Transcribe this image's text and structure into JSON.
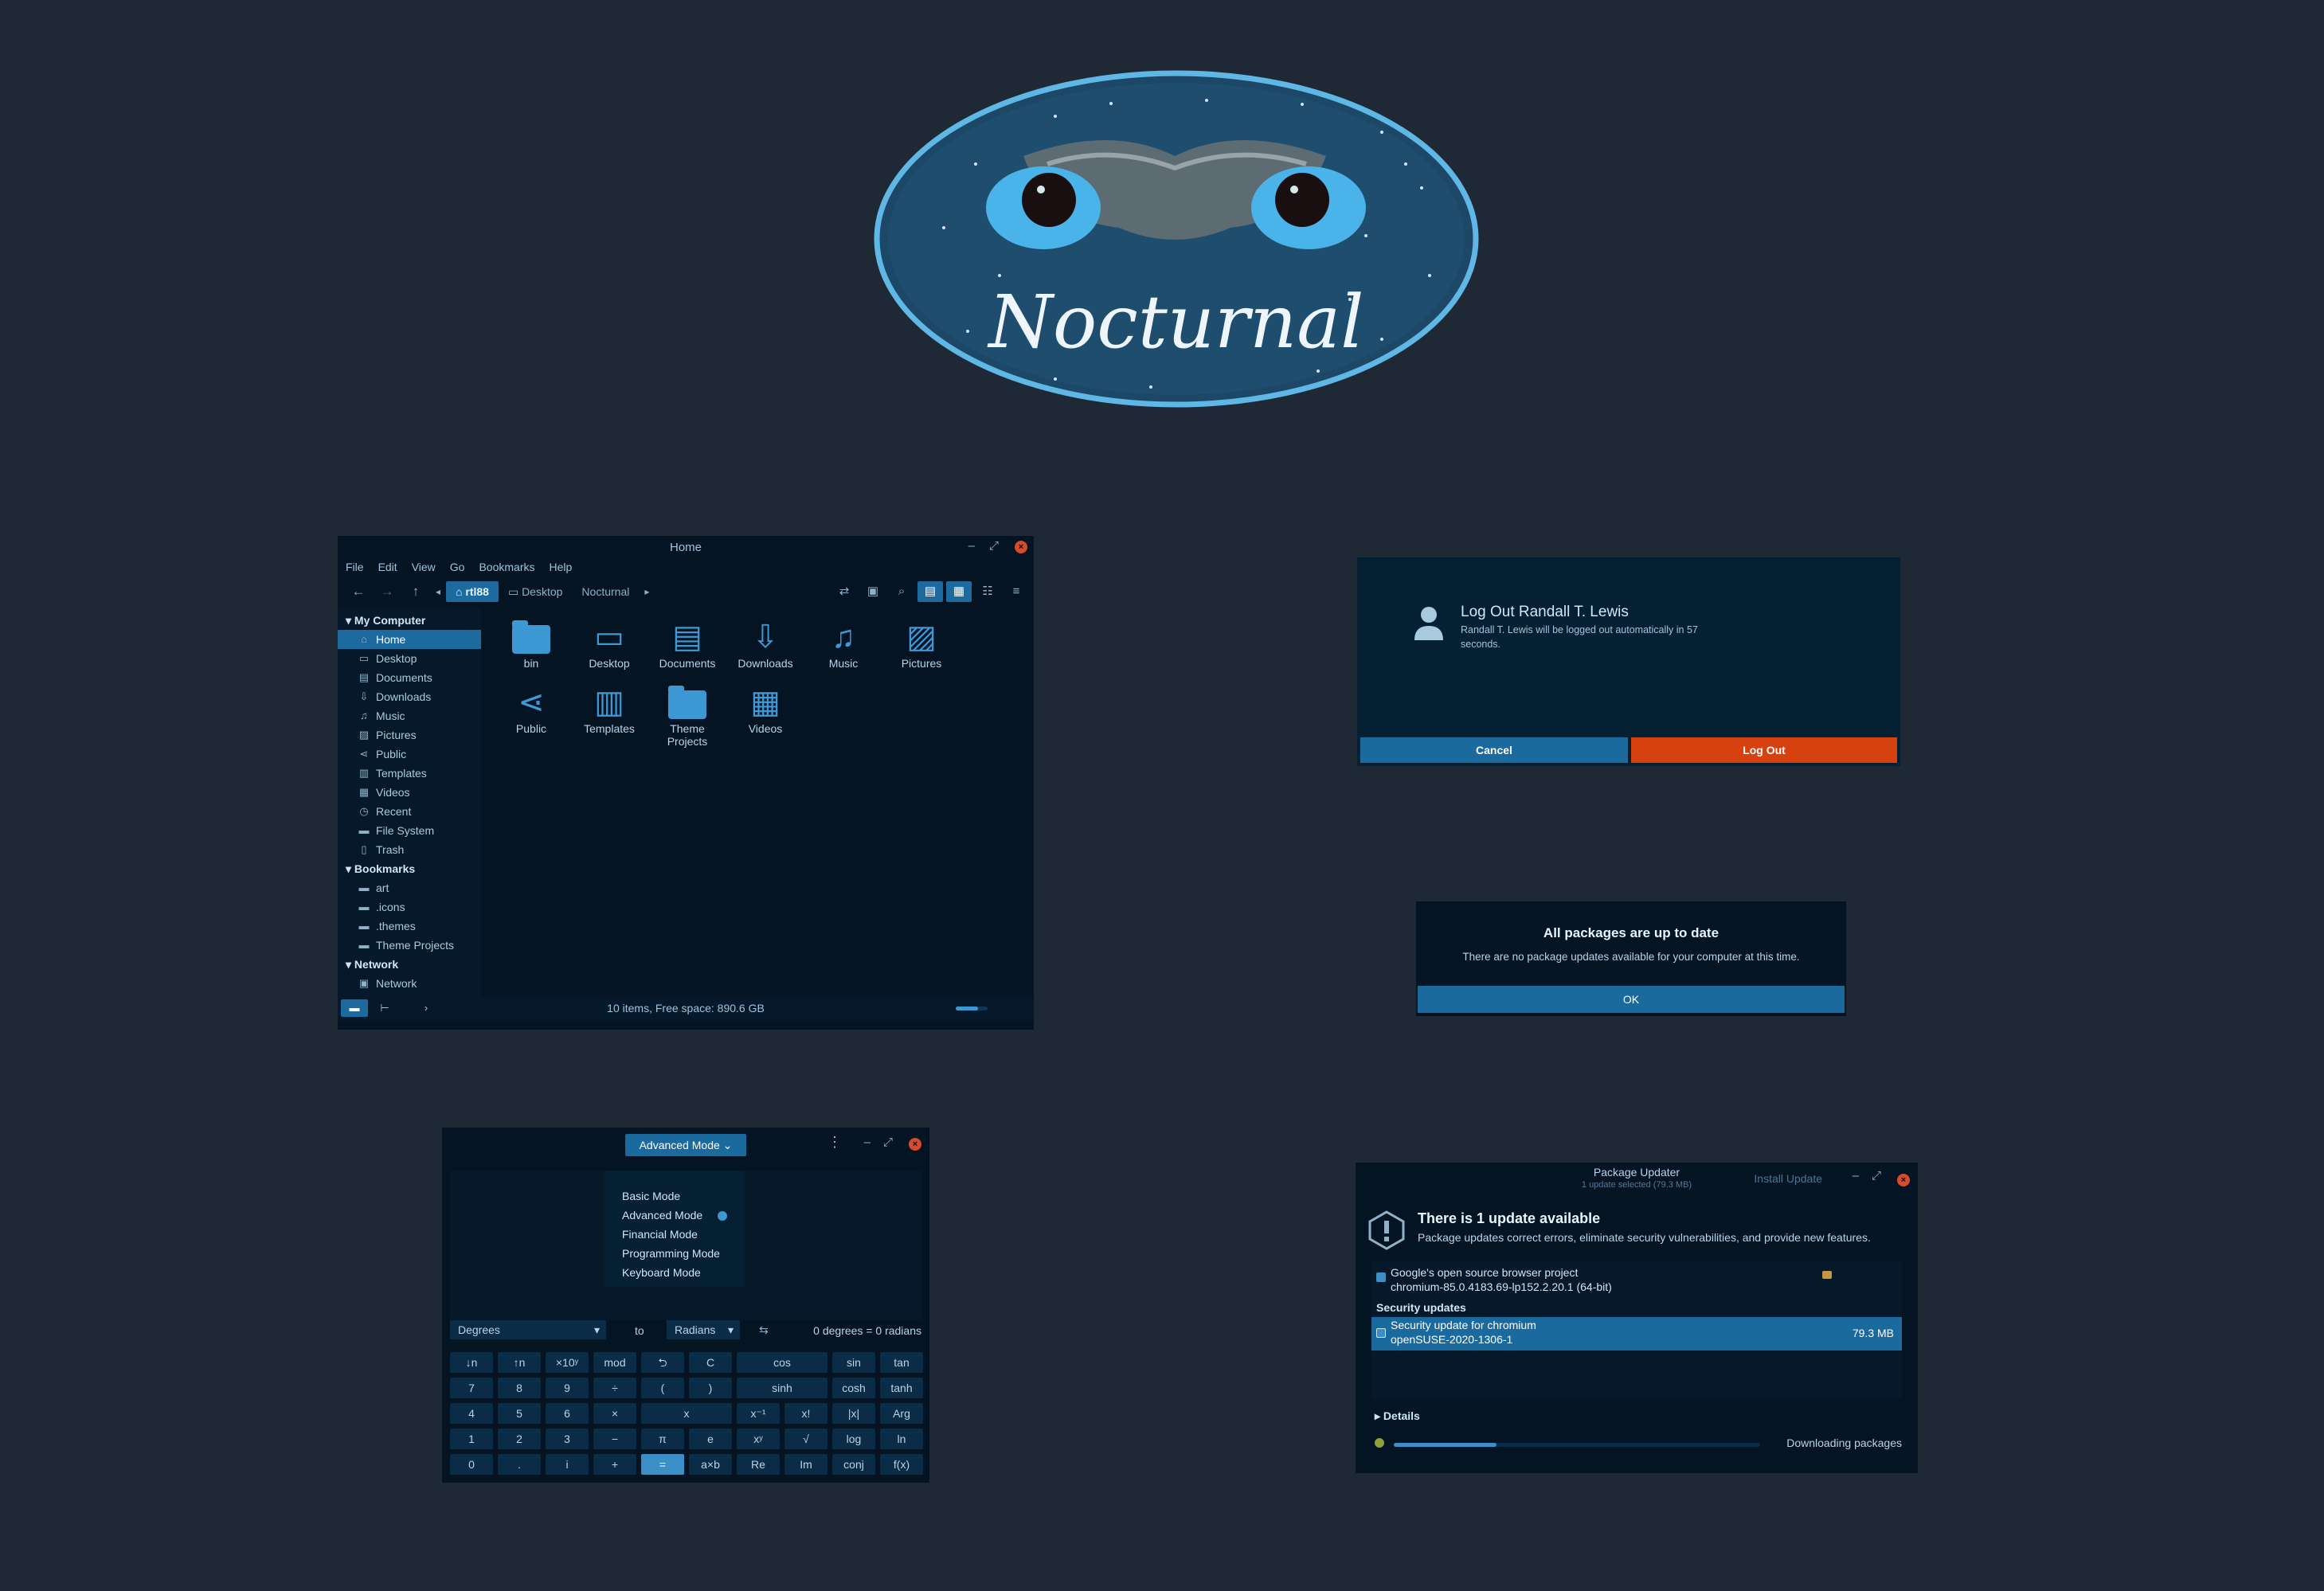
{
  "logo": {
    "text": "Nocturnal"
  },
  "file_manager": {
    "title": "Home",
    "menu": [
      "File",
      "Edit",
      "View",
      "Go",
      "Bookmarks",
      "Help"
    ],
    "breadcrumbs": [
      "rtl88",
      "Desktop",
      "Nocturnal"
    ],
    "sidebar": {
      "sections": [
        {
          "heading": "My Computer",
          "items": [
            {
              "label": "Home",
              "icon": "home-icon",
              "selected": true
            },
            {
              "label": "Desktop",
              "icon": "desktop-icon"
            },
            {
              "label": "Documents",
              "icon": "document-icon"
            },
            {
              "label": "Downloads",
              "icon": "download-icon"
            },
            {
              "label": "Music",
              "icon": "music-icon"
            },
            {
              "label": "Pictures",
              "icon": "picture-icon"
            },
            {
              "label": "Public",
              "icon": "share-icon"
            },
            {
              "label": "Templates",
              "icon": "template-icon"
            },
            {
              "label": "Videos",
              "icon": "video-icon"
            },
            {
              "label": "Recent",
              "icon": "recent-icon"
            },
            {
              "label": "File System",
              "icon": "drive-icon"
            },
            {
              "label": "Trash",
              "icon": "trash-icon"
            }
          ]
        },
        {
          "heading": "Bookmarks",
          "items": [
            {
              "label": "art",
              "icon": "folder-icon"
            },
            {
              "label": ".icons",
              "icon": "folder-icon"
            },
            {
              "label": ".themes",
              "icon": "folder-icon"
            },
            {
              "label": "Theme Projects",
              "icon": "folder-icon"
            }
          ]
        },
        {
          "heading": "Network",
          "items": [
            {
              "label": "Network",
              "icon": "network-icon"
            }
          ]
        }
      ]
    },
    "files": [
      {
        "label": "bin",
        "icon": "folder-icon"
      },
      {
        "label": "Desktop",
        "icon": "desktop-icon"
      },
      {
        "label": "Documents",
        "icon": "document-icon"
      },
      {
        "label": "Downloads",
        "icon": "download-icon"
      },
      {
        "label": "Music",
        "icon": "music-icon"
      },
      {
        "label": "Pictures",
        "icon": "picture-icon"
      },
      {
        "label": "Public",
        "icon": "share-icon"
      },
      {
        "label": "Templates",
        "icon": "template-icon"
      },
      {
        "label": "Theme Projects",
        "icon": "folder-icon"
      },
      {
        "label": "Videos",
        "icon": "video-icon"
      }
    ],
    "status": "10 items, Free space: 890.6 GB"
  },
  "logout": {
    "title": "Log Out Randall T. Lewis",
    "desc": "Randall T. Lewis will be logged out automatically in 57 seconds.",
    "cancel": "Cancel",
    "logout": "Log Out"
  },
  "uptodate": {
    "title": "All packages are up to date",
    "desc": "There are no package updates available for your computer at this time.",
    "ok": "OK"
  },
  "calculator": {
    "mode": "Advanced Mode",
    "modes": [
      "Basic Mode",
      "Advanced Mode",
      "Financial Mode",
      "Programming Mode",
      "Keyboard Mode"
    ],
    "selected_mode_index": 1,
    "from_unit": "Degrees",
    "to_label": "to",
    "to_unit": "Radians",
    "result": "0 degrees = 0 radians",
    "keys": [
      "↓n",
      "↑n",
      "×10ʸ",
      "mod",
      "⮌",
      "C",
      "cos",
      "sin",
      "tan",
      "7",
      "8",
      "9",
      "÷",
      "(",
      ")",
      "sinh",
      "cosh",
      "tanh",
      "4",
      "5",
      "6",
      "×",
      "x",
      "x⁻¹",
      "x!",
      "|x|",
      "Arg",
      "1",
      "2",
      "3",
      "−",
      "π",
      "e",
      "xʸ",
      "√",
      "log",
      "ln",
      "0",
      ".",
      "i",
      "+",
      "=",
      "a×b",
      "Re",
      "Im",
      "conj",
      "f(x)"
    ]
  },
  "package_updater": {
    "title": "Package Updater",
    "subtitle": "1 update selected (79.3 MB)",
    "install": "Install Update",
    "heading": "There is 1 update available",
    "desc": "Package updates correct errors, eliminate security vulnerabilities, and provide new features.",
    "item1": {
      "line1": "Google's open source browser project",
      "line2": "chromium-85.0.4183.69-lp152.2.20.1 (64-bit)"
    },
    "group": "Security updates",
    "item2": {
      "line1": "Security update for chromium",
      "line2": "openSUSE-2020-1306-1",
      "size": "79.3 MB"
    },
    "details": "Details",
    "progress": 0.28,
    "progress_label": "Downloading packages"
  },
  "colors": {
    "background": "#1f2936",
    "accent": "#1a6a9e",
    "danger": "#d6410f",
    "window": "#041423"
  }
}
